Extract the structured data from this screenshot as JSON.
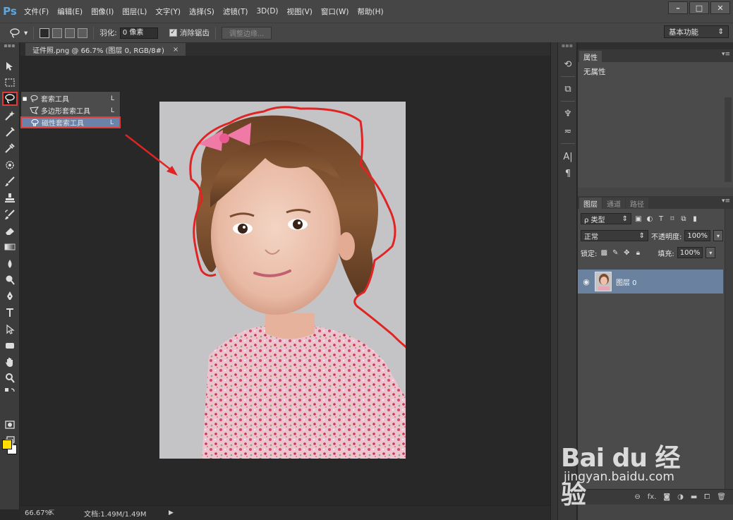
{
  "app": {
    "logo": "Ps"
  },
  "menu": [
    "文件(F)",
    "编辑(E)",
    "图像(I)",
    "图层(L)",
    "文字(Y)",
    "选择(S)",
    "滤镜(T)",
    "3D(D)",
    "视图(V)",
    "窗口(W)",
    "帮助(H)"
  ],
  "window_buttons": {
    "minimize": "–",
    "maximize": "□",
    "close": "✕"
  },
  "options": {
    "feather_label": "羽化:",
    "feather_value": "0 像素",
    "antialias_label": "消除锯齿",
    "antialias_checked": true,
    "refine_edge_label": "调整边缘...",
    "workspace_label": "基本功能"
  },
  "document": {
    "tab_label": "证件照.png @ 66.7% (图层 0, RGB/8#)",
    "tab_close": "×"
  },
  "status": {
    "zoom": "66.67%",
    "doc_size": "文档:1.49M/1.49M",
    "arrow": "▶"
  },
  "flyout": {
    "items": [
      {
        "label": "套索工具",
        "key": "L",
        "current": true
      },
      {
        "label": "多边形套索工具",
        "key": "L",
        "current": false
      },
      {
        "label": "磁性套索工具",
        "key": "L",
        "current": false,
        "highlighted": true
      }
    ]
  },
  "properties": {
    "tab": "属性",
    "body": "无属性"
  },
  "layers": {
    "tabs": [
      "图层",
      "通道",
      "路径"
    ],
    "filter_label": "ρ 类型",
    "blend_mode": "正常",
    "opacity_label": "不透明度:",
    "opacity_value": "100%",
    "lock_label": "锁定:",
    "fill_label": "填充:",
    "fill_value": "100%",
    "layer_name": "图层 0"
  },
  "watermark": {
    "brand": "Bai du 经验",
    "url": "jingyan.baidu.com"
  },
  "colors": {
    "foreground": "#ffde00",
    "background": "#ffffff",
    "selection_outline": "#e03a3a",
    "highlight": "#6a83a6"
  }
}
